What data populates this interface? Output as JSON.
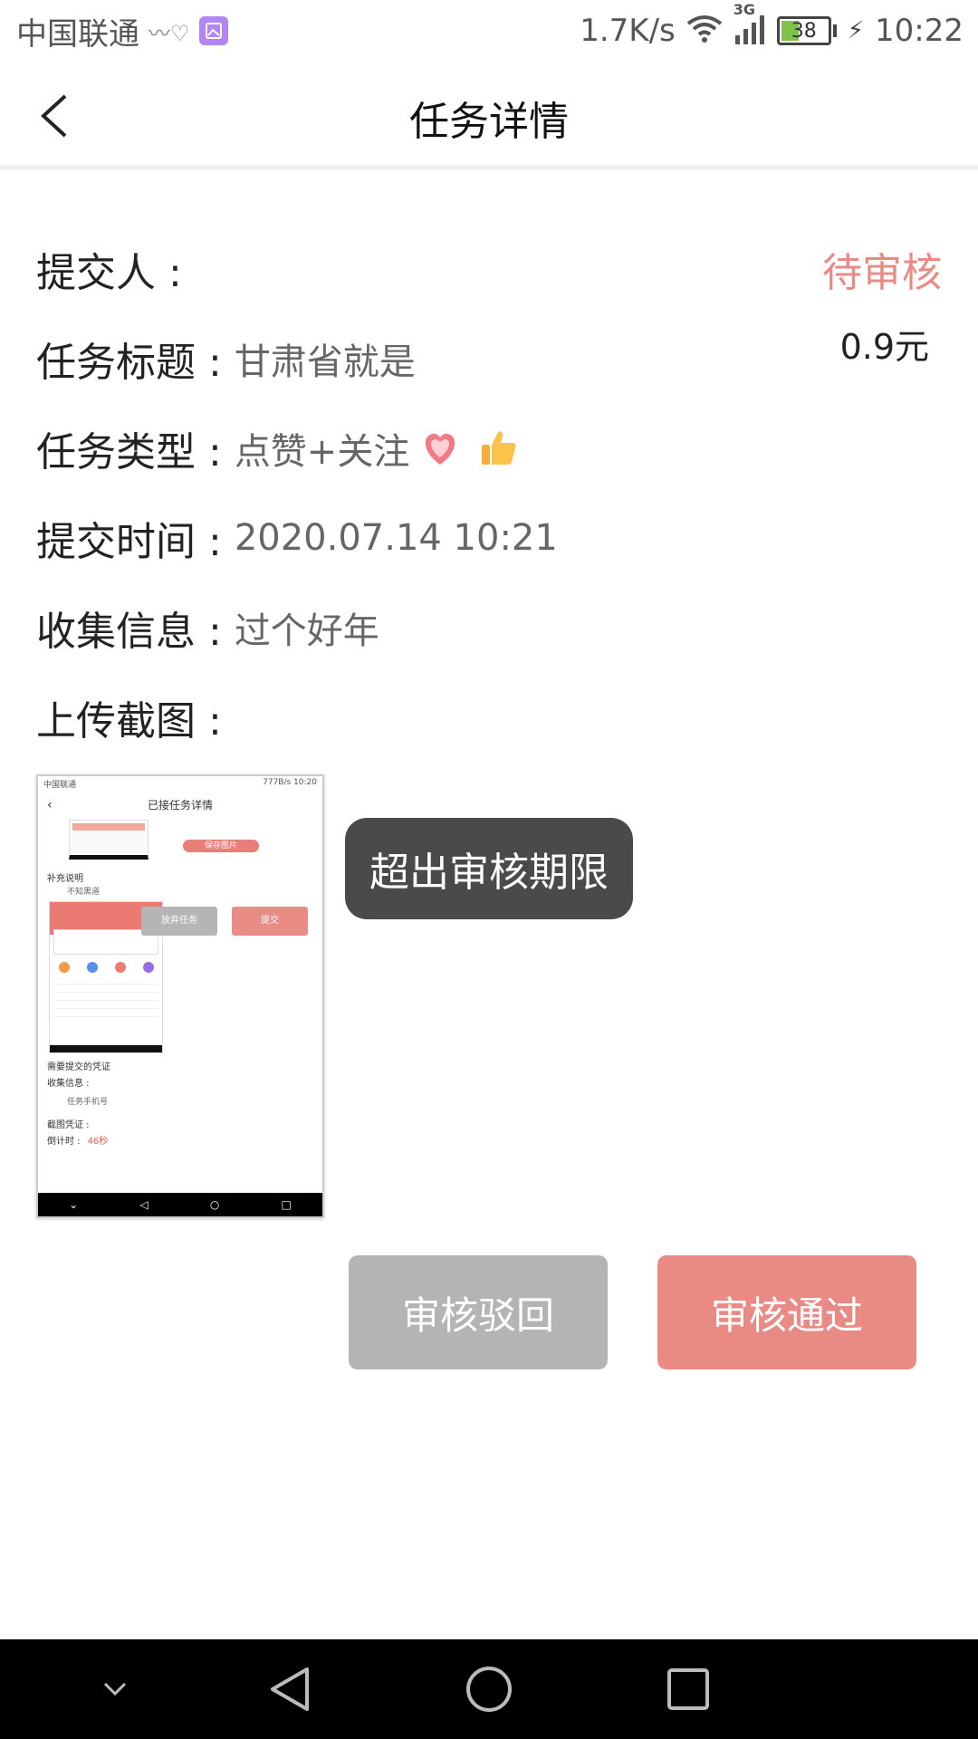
{
  "status_bar": {
    "carrier": "中国联通",
    "net_speed": "1.7K/s",
    "network_type": "3G",
    "battery": "38",
    "time": "10:22",
    "icons": [
      "heartbeat-icon",
      "gallery-icon",
      "wifi-icon",
      "signal-icon",
      "battery-icon",
      "charging-icon"
    ]
  },
  "header": {
    "title": "任务详情",
    "back_icon": "chevron-left-icon"
  },
  "details": {
    "submitter_label": "提交人 :",
    "submitter_value": "",
    "status": "待审核",
    "reward": "0.9元",
    "task_title_label": "任务标题 :",
    "task_title_value": "甘肃省就是",
    "task_type_label": "任务类型 :",
    "task_type_value": "点赞+关注",
    "submit_time_label": "提交时间 :",
    "submit_time_value": "2020.07.14 10:21",
    "collect_info_label": "收集信息 :",
    "collect_info_value": "过个好年",
    "upload_label": "上传截图 :"
  },
  "thumbnail": {
    "carrier": "中国联通",
    "status_right": "777B/s 10:20",
    "title": "已接任务详情",
    "save_button": "保存图片",
    "note_label": "补充说明",
    "note_value": "不知黑道",
    "give_up_button": "放弃任务",
    "submit_button": "提交",
    "need_label": "需要提交的凭证",
    "collect_label": "收集信息 :",
    "phone_label": "任务手机号",
    "screenshot_label": "截图凭证 :",
    "countdown_label": "倒计时 :",
    "countdown_value": "46秒"
  },
  "toast": "超出审核期限",
  "actions": {
    "reject": "审核驳回",
    "approve": "审核通过"
  },
  "colors": {
    "accent": "#e98b84",
    "reject_gray": "#b4b4b4",
    "toast_bg": "#4a4a4a",
    "nav_bg": "#000000"
  }
}
